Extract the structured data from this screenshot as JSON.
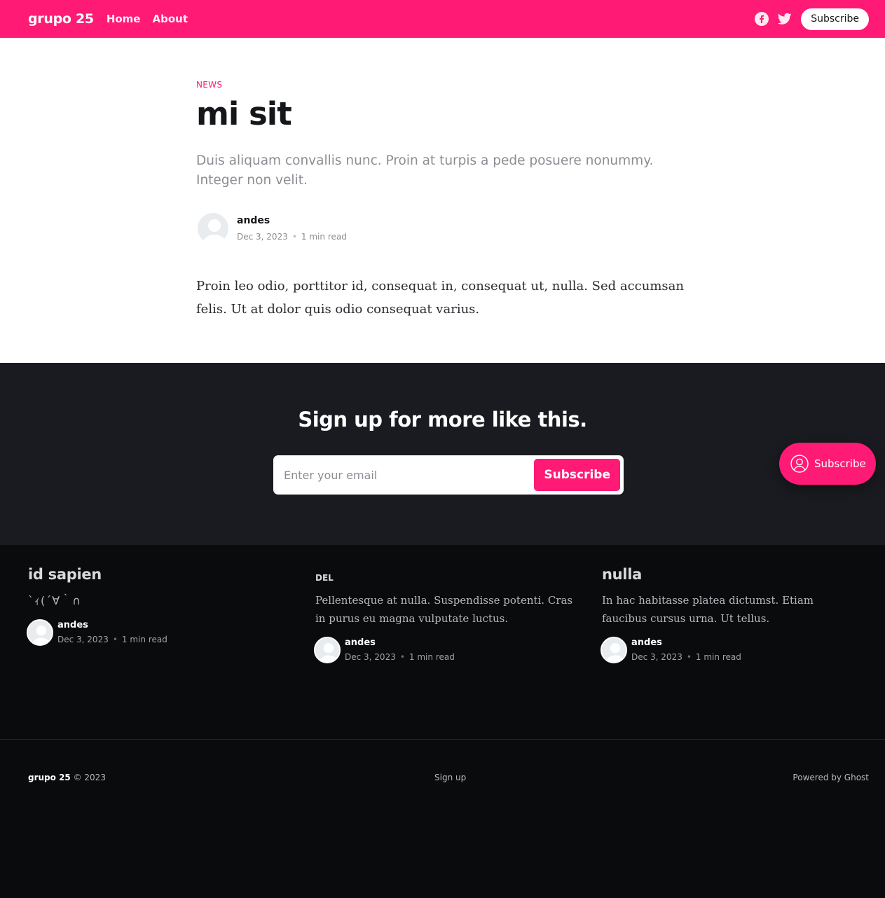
{
  "header": {
    "brand": "grupo 25",
    "nav": [
      "Home",
      "About"
    ],
    "social_icons": [
      "facebook-icon",
      "twitter-icon"
    ],
    "subscribe_label": "Subscribe",
    "accent_color": "#ff1a75"
  },
  "article": {
    "tag": "NEWS",
    "title": "mi sit",
    "excerpt": "Duis aliquam convallis nunc. Proin at turpis a pede posuere nonummy. Integer non velit.",
    "author": "andes",
    "date": "Dec 3, 2023",
    "dot": "•",
    "read_time": "1 min read",
    "content": "Proin leo odio, porttitor id, consequat in, consequat ut, nulla. Sed accumsan felis. Ut at dolor quis odio consequat varius."
  },
  "signup": {
    "title": "Sign up for more like this.",
    "email_placeholder": "Enter your email",
    "button_label": "Subscribe",
    "floating_button_label": "Subscribe"
  },
  "related": [
    {
      "title": "id sapien",
      "excerpt": "`ｨ(´∀｀∩",
      "author": "andes",
      "date": "Dec 3, 2023",
      "read_time": "1 min read"
    },
    {
      "tag": "DEL",
      "excerpt": "Pellentesque at nulla. Suspendisse potenti. Cras in purus eu magna vulputate luctus.",
      "author": "andes",
      "date": "Dec 3, 2023",
      "read_time": "1 min read"
    },
    {
      "title": "nulla",
      "excerpt": "In hac habitasse platea dictumst. Etiam faucibus cursus urna. Ut tellus.",
      "author": "andes",
      "date": "Dec 3, 2023",
      "read_time": "1 min read"
    }
  ],
  "footer": {
    "brand": "grupo 25",
    "copyright": "© 2023",
    "signup_link": "Sign up",
    "powered_by": "Powered by Ghost"
  }
}
